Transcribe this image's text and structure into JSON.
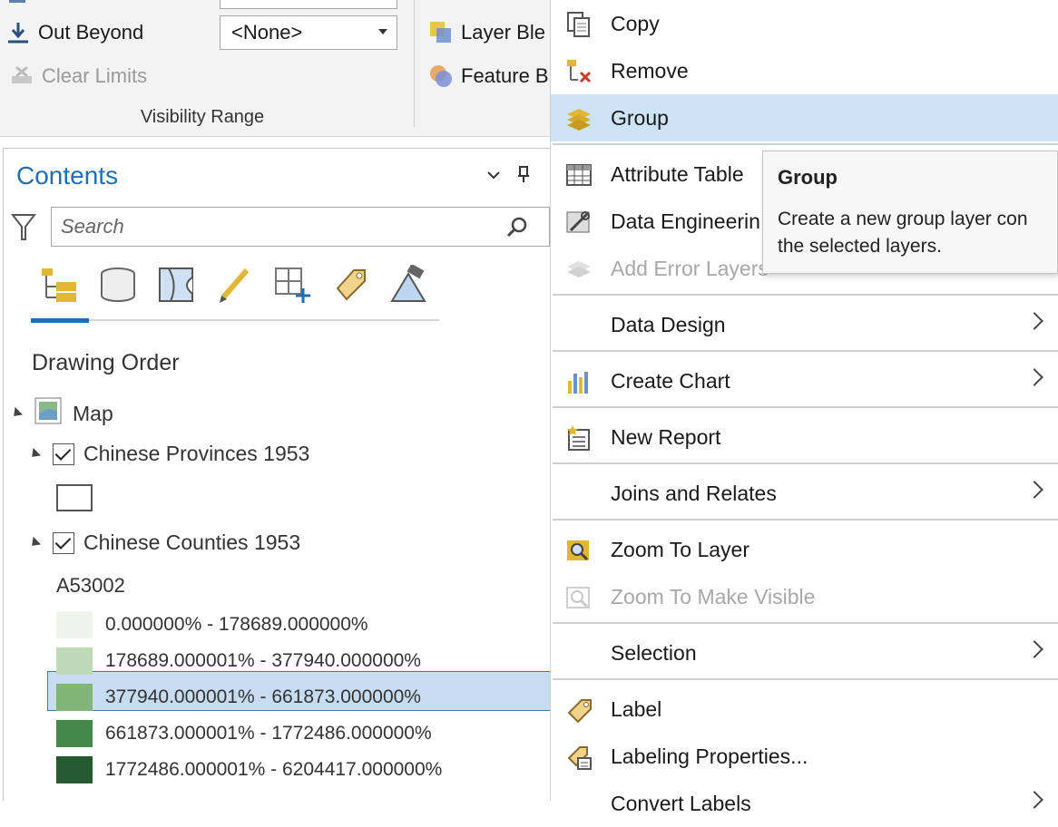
{
  "ribbon": {
    "out_beyond": "Out Beyond",
    "clear_limits": "Clear Limits",
    "dropdown_value": "<None>",
    "visibility_range": "Visibility Range",
    "layer_blend": "Layer Ble",
    "feature_blend": "Feature B"
  },
  "contents": {
    "title": "Contents",
    "search_placeholder": "Search",
    "section_title": "Drawing Order",
    "map_label": "Map",
    "layer1": "Chinese Provinces 1953",
    "layer2": "Chinese Counties 1953",
    "field": "A53002",
    "legend": [
      {
        "label": "0.000000% - 178689.000000%",
        "color": "#eef4ec"
      },
      {
        "label": "178689.000001% - 377940.000000%",
        "color": "#bcdab5"
      },
      {
        "label": "377940.000001% - 661873.000000%",
        "color": "#80b576"
      },
      {
        "label": "661873.000001% - 1772486.000000%",
        "color": "#45894a"
      },
      {
        "label": "1772486.000001% - 6204417.000000%",
        "color": "#245a2e"
      }
    ]
  },
  "menu": {
    "copy": "Copy",
    "remove": "Remove",
    "group": "Group",
    "attribute_table": "Attribute Table",
    "data_engineering": "Data Engineerin",
    "add_error_layers": "Add Error Layers",
    "data_design": "Data Design",
    "create_chart": "Create Chart",
    "new_report": "New Report",
    "joins_relates": "Joins and Relates",
    "zoom_to_layer": "Zoom To Layer",
    "zoom_to_visible": "Zoom To Make Visible",
    "selection": "Selection",
    "label": "Label",
    "labeling_properties": "Labeling Properties...",
    "convert_labels": "Convert Labels"
  },
  "tooltip": {
    "title": "Group",
    "line1": "Create a new group layer con",
    "line2": "the selected layers."
  },
  "colors": {
    "accent": "#1f6fb5",
    "highlight": "#cde4f7",
    "selected_row": "#c5dcf1"
  }
}
